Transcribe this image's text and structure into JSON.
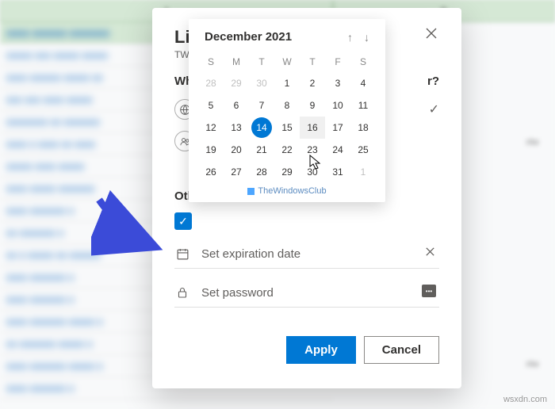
{
  "sheet": {
    "col_a": "A",
    "col_b": "B",
    "rite_label": "rite"
  },
  "modal": {
    "title": "Lin",
    "subtitle": "TWC",
    "section": "Who",
    "section_suffix": "r?",
    "other": "Othe",
    "checkbox_label": "",
    "field_expiration": "Set expiration date",
    "field_password": "Set password",
    "apply": "Apply",
    "cancel": "Cancel"
  },
  "calendar": {
    "title": "December 2021",
    "dow": [
      "S",
      "M",
      "T",
      "W",
      "T",
      "F",
      "S"
    ],
    "weeks": [
      [
        {
          "n": "28",
          "dim": true
        },
        {
          "n": "29",
          "dim": true
        },
        {
          "n": "30",
          "dim": true
        },
        {
          "n": "1"
        },
        {
          "n": "2"
        },
        {
          "n": "3"
        },
        {
          "n": "4"
        }
      ],
      [
        {
          "n": "5"
        },
        {
          "n": "6"
        },
        {
          "n": "7"
        },
        {
          "n": "8"
        },
        {
          "n": "9"
        },
        {
          "n": "10"
        },
        {
          "n": "11"
        }
      ],
      [
        {
          "n": "12"
        },
        {
          "n": "13"
        },
        {
          "n": "14",
          "sel": true
        },
        {
          "n": "15"
        },
        {
          "n": "16",
          "hov": true
        },
        {
          "n": "17"
        },
        {
          "n": "18"
        }
      ],
      [
        {
          "n": "19"
        },
        {
          "n": "20"
        },
        {
          "n": "21"
        },
        {
          "n": "22"
        },
        {
          "n": "23"
        },
        {
          "n": "24"
        },
        {
          "n": "25"
        }
      ],
      [
        {
          "n": "26"
        },
        {
          "n": "27"
        },
        {
          "n": "28"
        },
        {
          "n": "29"
        },
        {
          "n": "30"
        },
        {
          "n": "31"
        },
        {
          "n": "1",
          "dim": true
        }
      ]
    ],
    "watermark": "TheWindowsClub"
  },
  "page_watermark": "wsxdn.com"
}
